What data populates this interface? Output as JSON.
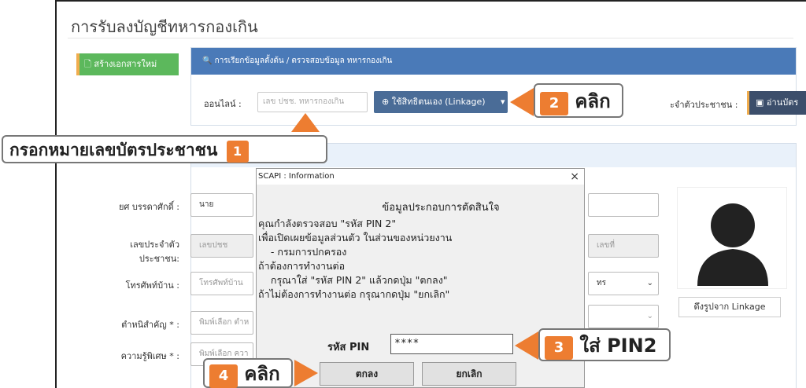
{
  "page": {
    "title": "การรับลงบัญชีทหารกองเกิน",
    "new_button": "สร้างเอกสารใหม่"
  },
  "search_panel": {
    "header": "การเรียกข้อมูลตั้งต้น / ตรวจสอบข้อมูล ทหารกองเกิน",
    "online_label": "ออนไลน์ :",
    "online_placeholder": "เลข ปชช. ทหารกองเกิน",
    "linkage_button": "ใช้สิทธิตนเอง (Linkage)",
    "id_label": "ะจำตัวประชาชน :",
    "card_button": "อ่านบัตร"
  },
  "form": {
    "rank_label": "ยศ บรรดาศักดิ์ :",
    "rank_value": "นาย",
    "id_label_1": "เลขประจำตัว",
    "id_label_2": "ประชาชน:",
    "id_value": "เลขปชช",
    "id_right": "เลขที่",
    "phone_label": "โทรศัพท์บ้าน :",
    "phone_placeholder": "โทรศัพท์บ้าน",
    "select_right": "ทร",
    "religion_label": "ตำหนิสำคัญ * :",
    "religion_placeholder": "พิมพ์เลือก ตำห",
    "skill_label": "ความรู้พิเศษ * :",
    "skill_placeholder": "พิมพ์เลือก ควา",
    "pull_photo_button": "ดึงรูปจาก Linkage"
  },
  "dialog": {
    "title": "SCAPI : Information",
    "close": "×",
    "heading": "ข้อมูลประกอบการตัดสินใจ",
    "lines": [
      "คุณกำลังตรวจสอบ \"รหัส PIN 2\"",
      "เพื่อเปิดเผยข้อมูลส่วนตัว ในส่วนของหน่วยงาน",
      "    - กรมการปกครอง",
      "ถ้าต้องการทำงานต่อ",
      "    กรุณาใส่ \"รหัส PIN 2\" แล้วกดปุ่ม \"ตกลง\"",
      "ถ้าไม่ต้องการทำงานต่อ กรุณากดปุ่ม \"ยกเลิก\""
    ],
    "pin_label": "รหัส PIN",
    "pin_value": "****",
    "ok_button": "ตกลง",
    "cancel_button": "ยกเลิก"
  },
  "callouts": {
    "step1_text": "กรอกหมายเลขบัตรประชาชน",
    "step1_num": "1",
    "step2_num": "2",
    "step2_text": "คลิก",
    "step3_num": "3",
    "step3_text": "ใส่ PIN2",
    "step4_num": "4",
    "step4_text": "คลิก"
  },
  "colors": {
    "callout_accent": "#ed7d31",
    "panel_header": "#4a7ab8"
  }
}
